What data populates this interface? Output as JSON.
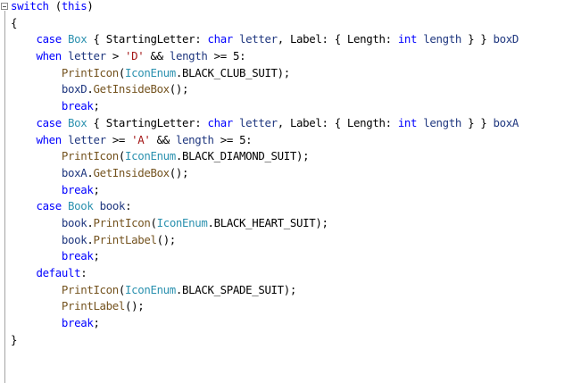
{
  "editor": {
    "colors": {
      "keyword": "#0000ff",
      "type": "#2b91af",
      "method": "#74531f",
      "local": "#1f377f",
      "string": "#a31515",
      "plain": "#000000",
      "background": "#ffffff"
    },
    "fold_icon": "collapse-minus-icon",
    "lines": [
      [
        {
          "t": "switch",
          "c": "kw"
        },
        {
          "t": " (",
          "c": "pu"
        },
        {
          "t": "this",
          "c": "kw"
        },
        {
          "t": ")",
          "c": "pu"
        }
      ],
      [
        {
          "t": "{",
          "c": "pu"
        }
      ],
      [
        {
          "t": "    ",
          "c": "pl"
        },
        {
          "t": "case",
          "c": "kw"
        },
        {
          "t": " ",
          "c": "pl"
        },
        {
          "t": "Box",
          "c": "ty"
        },
        {
          "t": " { StartingLetter: ",
          "c": "pl"
        },
        {
          "t": "char",
          "c": "kw"
        },
        {
          "t": " ",
          "c": "pl"
        },
        {
          "t": "letter",
          "c": "lc"
        },
        {
          "t": ", Label: { Length: ",
          "c": "pl"
        },
        {
          "t": "int",
          "c": "kw"
        },
        {
          "t": " ",
          "c": "pl"
        },
        {
          "t": "length",
          "c": "lc"
        },
        {
          "t": " } } ",
          "c": "pl"
        },
        {
          "t": "boxD",
          "c": "lc"
        }
      ],
      [
        {
          "t": "    ",
          "c": "pl"
        },
        {
          "t": "when",
          "c": "kw"
        },
        {
          "t": " ",
          "c": "pl"
        },
        {
          "t": "letter",
          "c": "lc"
        },
        {
          "t": " > ",
          "c": "pl"
        },
        {
          "t": "'D'",
          "c": "st"
        },
        {
          "t": " && ",
          "c": "pl"
        },
        {
          "t": "length",
          "c": "lc"
        },
        {
          "t": " >= 5:",
          "c": "pl"
        }
      ],
      [
        {
          "t": "        ",
          "c": "pl"
        },
        {
          "t": "PrintIcon",
          "c": "fn"
        },
        {
          "t": "(",
          "c": "pl"
        },
        {
          "t": "IconEnum",
          "c": "ty"
        },
        {
          "t": ".BLACK_CLUB_SUIT);",
          "c": "pl"
        }
      ],
      [
        {
          "t": "        ",
          "c": "pl"
        },
        {
          "t": "boxD",
          "c": "lc"
        },
        {
          "t": ".",
          "c": "pl"
        },
        {
          "t": "GetInsideBox",
          "c": "fn"
        },
        {
          "t": "();",
          "c": "pl"
        }
      ],
      [
        {
          "t": "        ",
          "c": "pl"
        },
        {
          "t": "break",
          "c": "kw"
        },
        {
          "t": ";",
          "c": "pl"
        }
      ],
      [
        {
          "t": "    ",
          "c": "pl"
        },
        {
          "t": "case",
          "c": "kw"
        },
        {
          "t": " ",
          "c": "pl"
        },
        {
          "t": "Box",
          "c": "ty"
        },
        {
          "t": " { StartingLetter: ",
          "c": "pl"
        },
        {
          "t": "char",
          "c": "kw"
        },
        {
          "t": " ",
          "c": "pl"
        },
        {
          "t": "letter",
          "c": "lc"
        },
        {
          "t": ", Label: { Length: ",
          "c": "pl"
        },
        {
          "t": "int",
          "c": "kw"
        },
        {
          "t": " ",
          "c": "pl"
        },
        {
          "t": "length",
          "c": "lc"
        },
        {
          "t": " } } ",
          "c": "pl"
        },
        {
          "t": "boxA",
          "c": "lc"
        }
      ],
      [
        {
          "t": "    ",
          "c": "pl"
        },
        {
          "t": "when",
          "c": "kw"
        },
        {
          "t": " ",
          "c": "pl"
        },
        {
          "t": "letter",
          "c": "lc"
        },
        {
          "t": " >= ",
          "c": "pl"
        },
        {
          "t": "'A'",
          "c": "st"
        },
        {
          "t": " && ",
          "c": "pl"
        },
        {
          "t": "length",
          "c": "lc"
        },
        {
          "t": " >= 5:",
          "c": "pl"
        }
      ],
      [
        {
          "t": "        ",
          "c": "pl"
        },
        {
          "t": "PrintIcon",
          "c": "fn"
        },
        {
          "t": "(",
          "c": "pl"
        },
        {
          "t": "IconEnum",
          "c": "ty"
        },
        {
          "t": ".BLACK_DIAMOND_SUIT);",
          "c": "pl"
        }
      ],
      [
        {
          "t": "        ",
          "c": "pl"
        },
        {
          "t": "boxA",
          "c": "lc"
        },
        {
          "t": ".",
          "c": "pl"
        },
        {
          "t": "GetInsideBox",
          "c": "fn"
        },
        {
          "t": "();",
          "c": "pl"
        }
      ],
      [
        {
          "t": "        ",
          "c": "pl"
        },
        {
          "t": "break",
          "c": "kw"
        },
        {
          "t": ";",
          "c": "pl"
        }
      ],
      [
        {
          "t": "    ",
          "c": "pl"
        },
        {
          "t": "case",
          "c": "kw"
        },
        {
          "t": " ",
          "c": "pl"
        },
        {
          "t": "Book",
          "c": "ty"
        },
        {
          "t": " ",
          "c": "pl"
        },
        {
          "t": "book",
          "c": "lc"
        },
        {
          "t": ":",
          "c": "pl"
        }
      ],
      [
        {
          "t": "        ",
          "c": "pl"
        },
        {
          "t": "book",
          "c": "lc"
        },
        {
          "t": ".",
          "c": "pl"
        },
        {
          "t": "PrintIcon",
          "c": "fn"
        },
        {
          "t": "(",
          "c": "pl"
        },
        {
          "t": "IconEnum",
          "c": "ty"
        },
        {
          "t": ".BLACK_HEART_SUIT);",
          "c": "pl"
        }
      ],
      [
        {
          "t": "        ",
          "c": "pl"
        },
        {
          "t": "book",
          "c": "lc"
        },
        {
          "t": ".",
          "c": "pl"
        },
        {
          "t": "PrintLabel",
          "c": "fn"
        },
        {
          "t": "();",
          "c": "pl"
        }
      ],
      [
        {
          "t": "        ",
          "c": "pl"
        },
        {
          "t": "break",
          "c": "kw"
        },
        {
          "t": ";",
          "c": "pl"
        }
      ],
      [
        {
          "t": "    ",
          "c": "pl"
        },
        {
          "t": "default",
          "c": "kw"
        },
        {
          "t": ":",
          "c": "pl"
        }
      ],
      [
        {
          "t": "        ",
          "c": "pl"
        },
        {
          "t": "PrintIcon",
          "c": "fn"
        },
        {
          "t": "(",
          "c": "pl"
        },
        {
          "t": "IconEnum",
          "c": "ty"
        },
        {
          "t": ".BLACK_SPADE_SUIT);",
          "c": "pl"
        }
      ],
      [
        {
          "t": "        ",
          "c": "pl"
        },
        {
          "t": "PrintLabel",
          "c": "fn"
        },
        {
          "t": "();",
          "c": "pl"
        }
      ],
      [
        {
          "t": "        ",
          "c": "pl"
        },
        {
          "t": "break",
          "c": "kw"
        },
        {
          "t": ";",
          "c": "pl"
        }
      ],
      [
        {
          "t": "}",
          "c": "pu"
        }
      ]
    ]
  }
}
